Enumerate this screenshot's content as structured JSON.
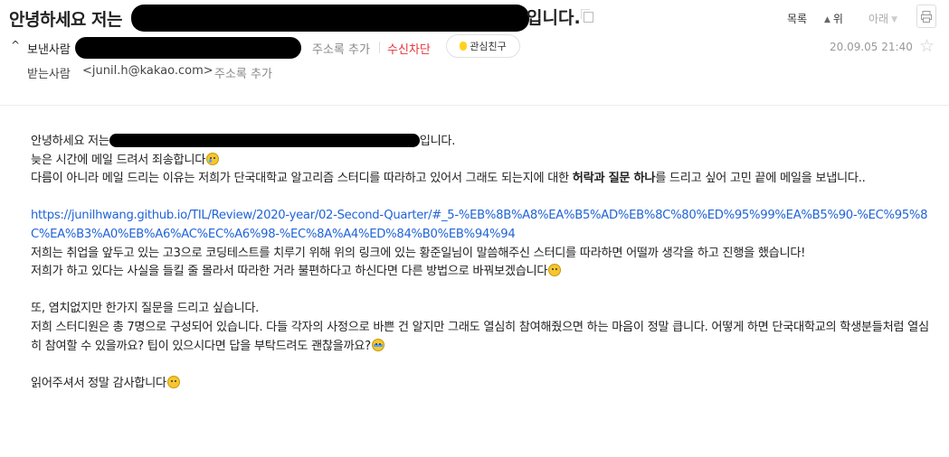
{
  "header": {
    "subject_prefix": "안녕하세요 저는",
    "subject_suffix": "입니다.",
    "nav": {
      "list": "목록",
      "up": "위",
      "down": "아래"
    }
  },
  "sender": {
    "label": "보낸사람",
    "add_contact": "주소록 추가",
    "block": "수신차단",
    "interest": "관심친구",
    "date": "20.09.05 21:40"
  },
  "recipient": {
    "label": "받는사람",
    "address": "<junil.h@kakao.com>",
    "add_contact": "주소록 추가"
  },
  "body": {
    "line1_prefix": "안녕하세요 저는",
    "line1_suffix": "입니다.",
    "line2": "늦은 시간에 메일 드려서 죄송합니다",
    "line3_a": "다름이 아니라 메일 드리는 이유는 저희가 단국대학교 알고리즘 스터디를 따라하고 있어서 그래도 되는지에 대한 ",
    "line3_bold": "허락과 질문 하나",
    "line3_b": "를 드리고 싶어 고민 끝에 메일을 보냅니다..",
    "link": "https://junilhwang.github.io/TIL/Review/2020-year/02-Second-Quarter/#_5-%EB%8B%A8%EA%B5%AD%EB%8C%80%ED%95%99%EA%B5%90-%EC%95%8C%EA%B3%A0%EB%A6%AC%EC%A6%98-%EC%8A%A4%ED%84%B0%EB%94%94",
    "para2": "저희는 취업을 앞두고 있는 고3으로 코딩테스트를 치루기 위해 위의 링크에 있는 황준일님이 말씀해주신 스터디를 따라하면 어떨까 생각을 하고 진행을 했습니다!",
    "para3": "저희가 하고 있다는 사실을 들킬 줄 몰라서 따라한 거라 불편하다고 하신다면 다른 방법으로 바꿔보겠습니다",
    "para4": "또, 염치없지만 한가지 질문을 드리고 싶습니다.",
    "para5": "저희 스터디원은 총 7명으로 구성되어 있습니다. 다들 각자의 사정으로 바쁜 건 알지만 그래도 열심히 참여해줬으면 하는 마음이 정말 큽니다. 어떻게 하면 단국대학교의 학생분들처럼 열심히 참여할 수 있을까요? 팁이 있으시다면 답을 부탁드려도 괜찮을까요?",
    "para6": "읽어주셔서 정말 감사합니다"
  }
}
